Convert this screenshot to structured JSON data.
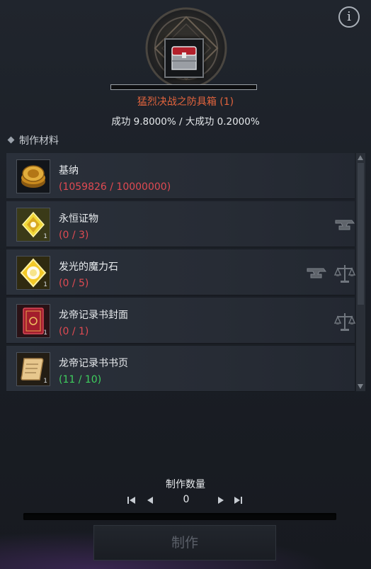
{
  "header": {
    "info_icon_glyph": "i",
    "item_name": "猛烈决战之防具箱 (1)",
    "success_rates": "成功 9.8000% / 大成功 0.2000%",
    "item_name_color": "#e2643d"
  },
  "materials": {
    "section_title": "制作材料",
    "items": [
      {
        "name": "基纳",
        "count": "(1059826 / 10000000)",
        "qty_badge": "",
        "icon": "kinah-coin-icon",
        "sufficient": false
      },
      {
        "name": "永恒证物",
        "count": "(0 / 3)",
        "qty_badge": "1",
        "icon": "eternal-evidence-icon",
        "sufficient": false,
        "actions": [
          "anvil-icon"
        ]
      },
      {
        "name": "发光的魔力石",
        "count": "(0 / 5)",
        "qty_badge": "1",
        "icon": "glowing-manastone-icon",
        "sufficient": false,
        "actions": [
          "anvil-icon",
          "scales-icon"
        ]
      },
      {
        "name": "龙帝记录书封面",
        "count": "(0 / 1)",
        "qty_badge": "1",
        "icon": "dragon-book-cover-icon",
        "sufficient": false,
        "actions": [
          "scales-icon"
        ]
      },
      {
        "name": "龙帝记录书书页",
        "count": "(11 / 10)",
        "qty_badge": "1",
        "icon": "dragon-book-page-icon",
        "sufficient": true
      }
    ],
    "colors": {
      "insufficient": "#e04a52",
      "sufficient": "#3fcf5e"
    }
  },
  "quantity": {
    "title": "制作数量",
    "value": "0"
  },
  "craft_button": {
    "label": "制作"
  }
}
